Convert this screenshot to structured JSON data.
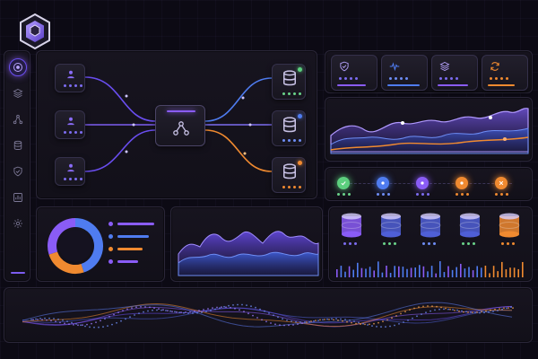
{
  "app": {
    "logo_icon": "hex-cube-logo-icon",
    "accent_purple": "#8a5cf6",
    "accent_blue": "#4f7cf0",
    "accent_orange": "#f08a30",
    "accent_green": "#5ccf7e"
  },
  "sidebar": {
    "items": [
      {
        "icon": "target-icon",
        "active": true
      },
      {
        "icon": "layers-icon",
        "active": false
      },
      {
        "icon": "nodes-icon",
        "active": false
      },
      {
        "icon": "database-icon",
        "active": false
      },
      {
        "icon": "shield-icon",
        "active": false
      },
      {
        "icon": "bar-chart-icon",
        "active": false
      },
      {
        "icon": "gear-icon",
        "active": false
      }
    ]
  },
  "flow": {
    "sources": [
      {
        "icon": "user-icon"
      },
      {
        "icon": "user-icon"
      },
      {
        "icon": "user-icon"
      }
    ],
    "hub": {
      "icon": "network-hub-icon"
    },
    "targets": [
      {
        "icon": "database-icon",
        "status": "green"
      },
      {
        "icon": "database-icon",
        "status": "blue"
      },
      {
        "icon": "database-icon",
        "status": "orange"
      }
    ]
  },
  "status_tiles": [
    {
      "icon": "shield-icon",
      "bar_fill": 0.8,
      "color": "#8a5cf6"
    },
    {
      "icon": "pulse-icon",
      "bar_fill": 0.9,
      "color": "#4f7cf0"
    },
    {
      "icon": "layers-icon",
      "bar_fill": 0.85,
      "color": "#8a5cf6"
    },
    {
      "icon": "refresh-icon",
      "bar_fill": 0.75,
      "color": "#f08a30"
    }
  ],
  "pipeline": {
    "steps": [
      {
        "icon": "check-icon",
        "color": "#5ccf7e"
      },
      {
        "icon": "dot-icon",
        "color": "#4f7cf0"
      },
      {
        "icon": "dot-icon",
        "color": "#8a5cf6"
      },
      {
        "icon": "dot-icon",
        "color": "#f08a30"
      },
      {
        "icon": "close-icon",
        "color": "#f08a30"
      }
    ]
  },
  "donut": {
    "segments": [
      {
        "value": 0.45,
        "color": "#4f7cf0"
      },
      {
        "value": 0.25,
        "color": "#f08a30"
      },
      {
        "value": 0.3,
        "color": "#8a5cf6"
      }
    ],
    "legend_bars": [
      {
        "color": "#8a5cf6",
        "fill": 0.9
      },
      {
        "color": "#4f7cf0",
        "fill": 0.75
      },
      {
        "color": "#f08a30",
        "fill": 0.6
      },
      {
        "color": "#8a5cf6",
        "fill": 0.5
      }
    ]
  },
  "db_cluster": {
    "nodes": [
      {
        "color": "#8a5cf6",
        "status": "purple"
      },
      {
        "color": "#4f5fd6",
        "status": "green"
      },
      {
        "color": "#4f5fd6",
        "status": "blue"
      },
      {
        "color": "#4f5fd6",
        "status": "green"
      },
      {
        "color": "#f08a30",
        "status": "orange"
      }
    ]
  }
}
